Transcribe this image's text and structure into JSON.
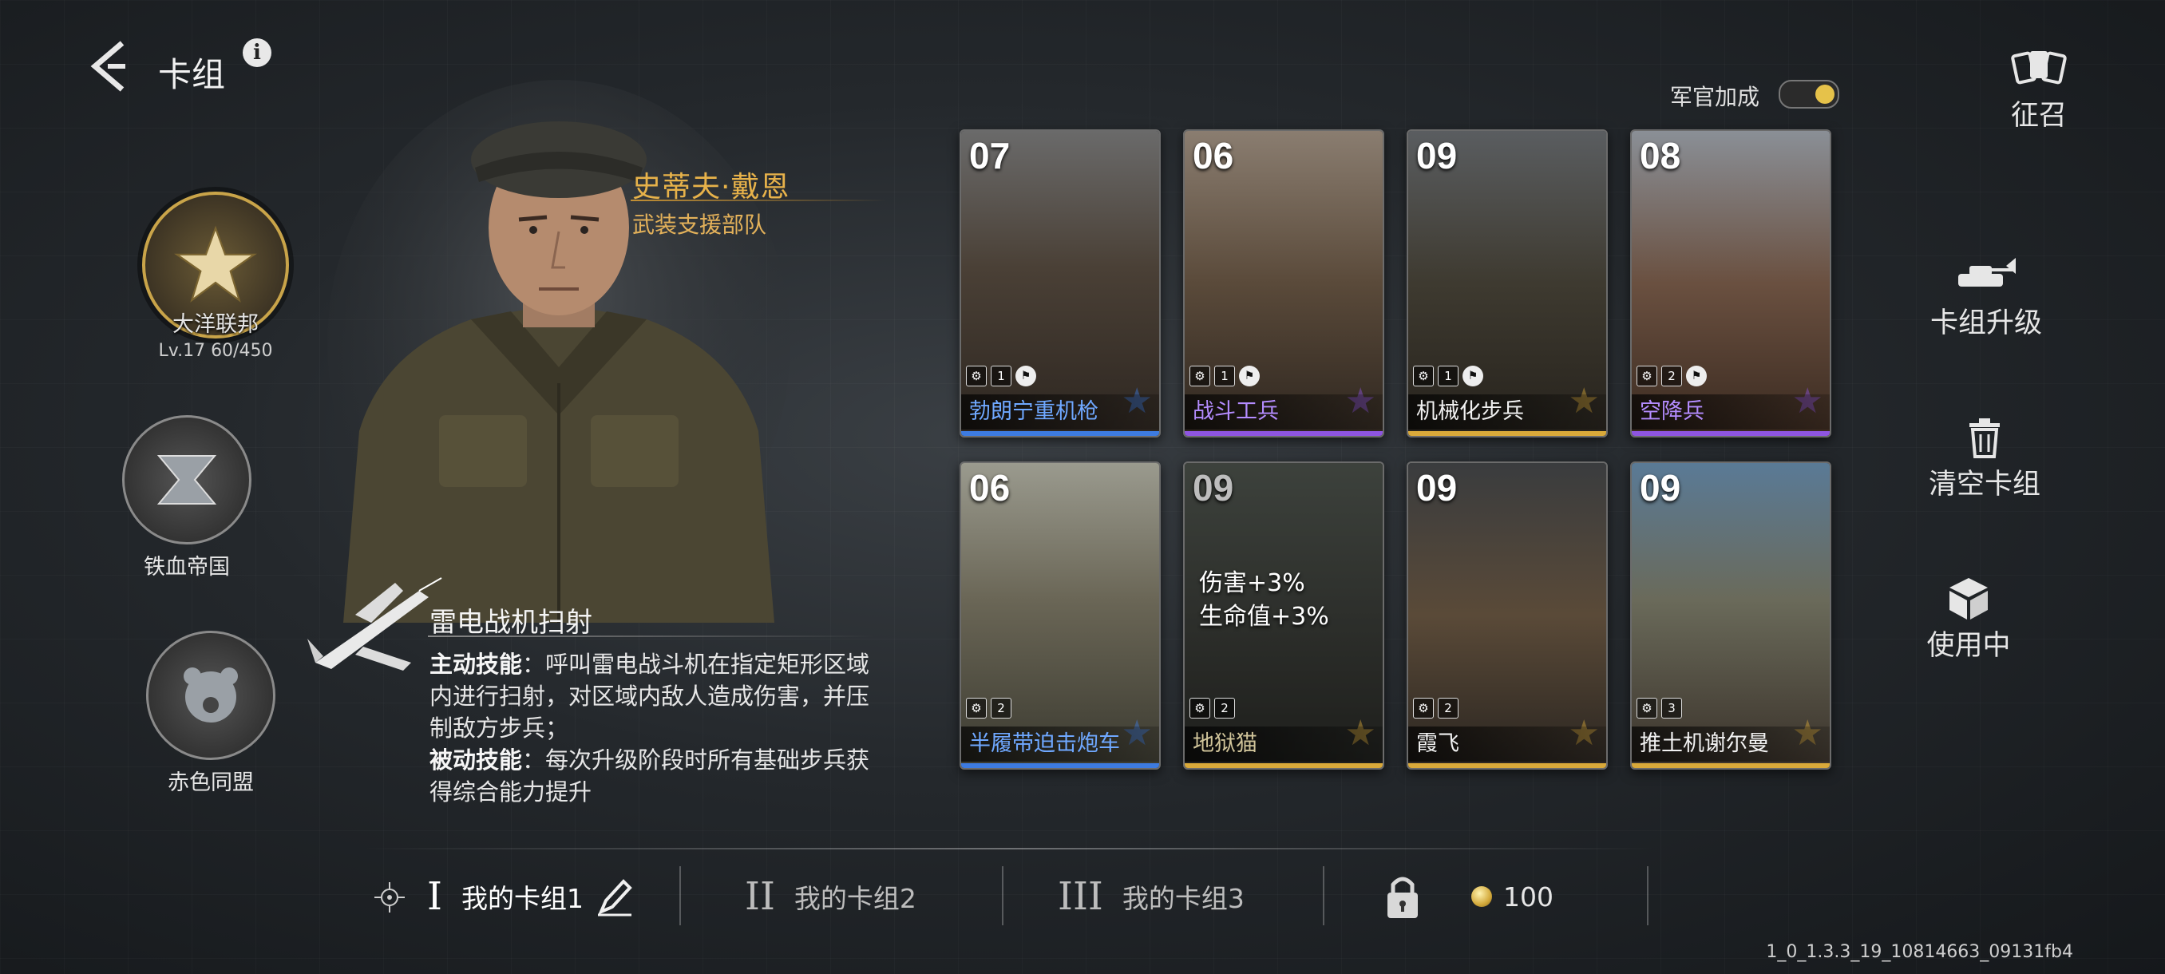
{
  "header": {
    "title": "卡组",
    "info_glyph": "i"
  },
  "factions": [
    {
      "name": "大洋联邦",
      "level": "Lv.17  60/450",
      "icon": "star-eagle-icon",
      "selected": true
    },
    {
      "name": "铁血帝国",
      "icon": "iron-eagle-icon",
      "selected": false
    },
    {
      "name": "赤色同盟",
      "icon": "bear-icon",
      "selected": false
    }
  ],
  "officer": {
    "name": "史蒂夫·戴恩",
    "unit": "武装支援部队"
  },
  "skill": {
    "title": "雷电战机扫射",
    "active_label": "主动技能",
    "active_text": "：呼叫雷电战斗机在指定矩形区域内进行扫射，对区域内敌人造成伤害，并压制敌方步兵；",
    "passive_label": "被动技能",
    "passive_text": "：每次升级阶段时所有基础步兵获得综合能力提升"
  },
  "toggle": {
    "label": "军官加成",
    "on": true
  },
  "right_menu": {
    "recruit": "征召",
    "upgrade": "卡组升级",
    "clear": "清空卡组",
    "in_use": "使用中"
  },
  "cards": [
    {
      "cost": "07",
      "name": "勃朗宁重机枪",
      "count": "1",
      "type_icon": "machine-gun-icon",
      "rarity_color": "#3d7be0",
      "name_color": "#6fa8ff"
    },
    {
      "cost": "06",
      "name": "战斗工兵",
      "count": "1",
      "type_icon": "wrench-icon",
      "rarity_color": "#8e55e0",
      "name_color": "#b48cff"
    },
    {
      "cost": "09",
      "name": "机械化步兵",
      "count": "1",
      "type_icon": "mech-infantry-icon",
      "rarity_color": "#d9a93a",
      "name_color": "#f1f1f1"
    },
    {
      "cost": "08",
      "name": "空降兵",
      "count": "2",
      "type_icon": "parachute-icon",
      "rarity_color": "#8e55e0",
      "name_color": "#b48cff"
    },
    {
      "cost": "06",
      "name": "半履带迫击炮车",
      "count": "2",
      "type_icon": "halftrack-icon",
      "rarity_color": "#3d7be0",
      "name_color": "#6fa8ff"
    },
    {
      "cost": "09",
      "name": "地狱猫",
      "count": "2",
      "type_icon": "tank-icon",
      "rarity_color": "#d9a93a",
      "name_color": "#d0c49a",
      "buff": [
        "伤害+3%",
        "生命值+3%"
      ],
      "dim": true
    },
    {
      "cost": "09",
      "name": "霞飞",
      "count": "2",
      "type_icon": "tank-icon",
      "rarity_color": "#d9a93a",
      "name_color": "#f1f1f1"
    },
    {
      "cost": "09",
      "name": "推土机谢尔曼",
      "count": "3",
      "type_icon": "tank-icon",
      "rarity_color": "#d9a93a",
      "name_color": "#f1f1f1"
    }
  ],
  "decks": [
    {
      "roman": "I",
      "label": "我的卡组1",
      "active": true
    },
    {
      "roman": "II",
      "label": "我的卡组2",
      "active": false
    },
    {
      "roman": "III",
      "label": "我的卡组3",
      "active": false
    }
  ],
  "locked_deck": {
    "cost": "100"
  },
  "version": "1_0_1.3.3_19_10814663_09131fb4"
}
